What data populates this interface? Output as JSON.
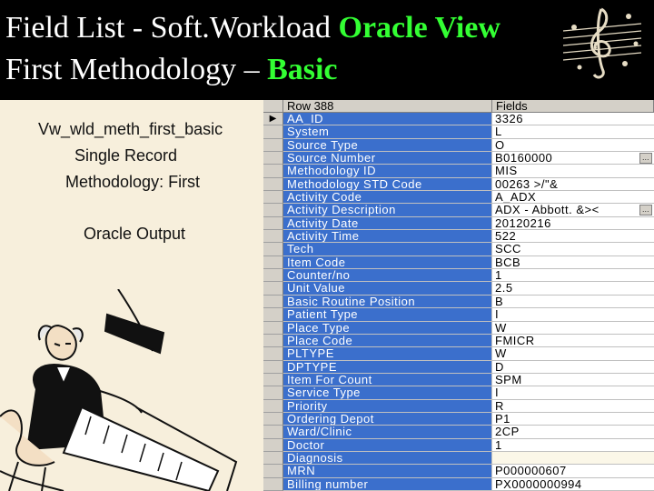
{
  "title": {
    "line1_main": "Field List - Soft.Workload ",
    "line1_accent": "Oracle View",
    "line2_main": "First Methodology – ",
    "line2_accent": "Basic"
  },
  "notes": {
    "view_name": "Vw_wld_meth_first_basic",
    "record": "Single Record",
    "methodology": "Methodology: First",
    "output": "Oracle Output"
  },
  "grid": {
    "header_name": "Row 388",
    "header_value": "Fields",
    "current_marker": "▶",
    "dropdown_glyph": "…",
    "rows": [
      {
        "name": "AA_ID",
        "value": "3326"
      },
      {
        "name": "System",
        "value": "L"
      },
      {
        "name": "Source Type",
        "value": "O"
      },
      {
        "name": "Source Number",
        "value": "B0160000"
      },
      {
        "name": "Methodology ID",
        "value": "MIS"
      },
      {
        "name": "Methodology STD Code",
        "value": "00263 >/\"&"
      },
      {
        "name": "Activity Code",
        "value": "A_ADX"
      },
      {
        "name": "Activity Description",
        "value": "ADX - Abbott. &><"
      },
      {
        "name": "Activity Date",
        "value": "20120216"
      },
      {
        "name": "Activity Time",
        "value": "522"
      },
      {
        "name": "Tech",
        "value": "SCC"
      },
      {
        "name": "Item Code",
        "value": "BCB"
      },
      {
        "name": "Counter/no",
        "value": "1"
      },
      {
        "name": "Unit Value",
        "value": "2.5"
      },
      {
        "name": "Basic Routine Position",
        "value": "B"
      },
      {
        "name": "Patient Type",
        "value": "I"
      },
      {
        "name": "Place Type",
        "value": "W"
      },
      {
        "name": "Place Code",
        "value": "FMICR"
      },
      {
        "name": "PLTYPE",
        "value": "W"
      },
      {
        "name": "DPTYPE",
        "value": "D"
      },
      {
        "name": "Item For Count",
        "value": "SPM"
      },
      {
        "name": "Service Type",
        "value": "I"
      },
      {
        "name": "Priority",
        "value": "R"
      },
      {
        "name": "Ordering Depot",
        "value": "P1"
      },
      {
        "name": "Ward/Clinic",
        "value": "2CP"
      },
      {
        "name": "Doctor",
        "value": "1"
      },
      {
        "name": "Diagnosis",
        "value": ""
      },
      {
        "name": "MRN",
        "value": "P000000607"
      },
      {
        "name": "Billing number",
        "value": "PX0000000994"
      }
    ]
  }
}
